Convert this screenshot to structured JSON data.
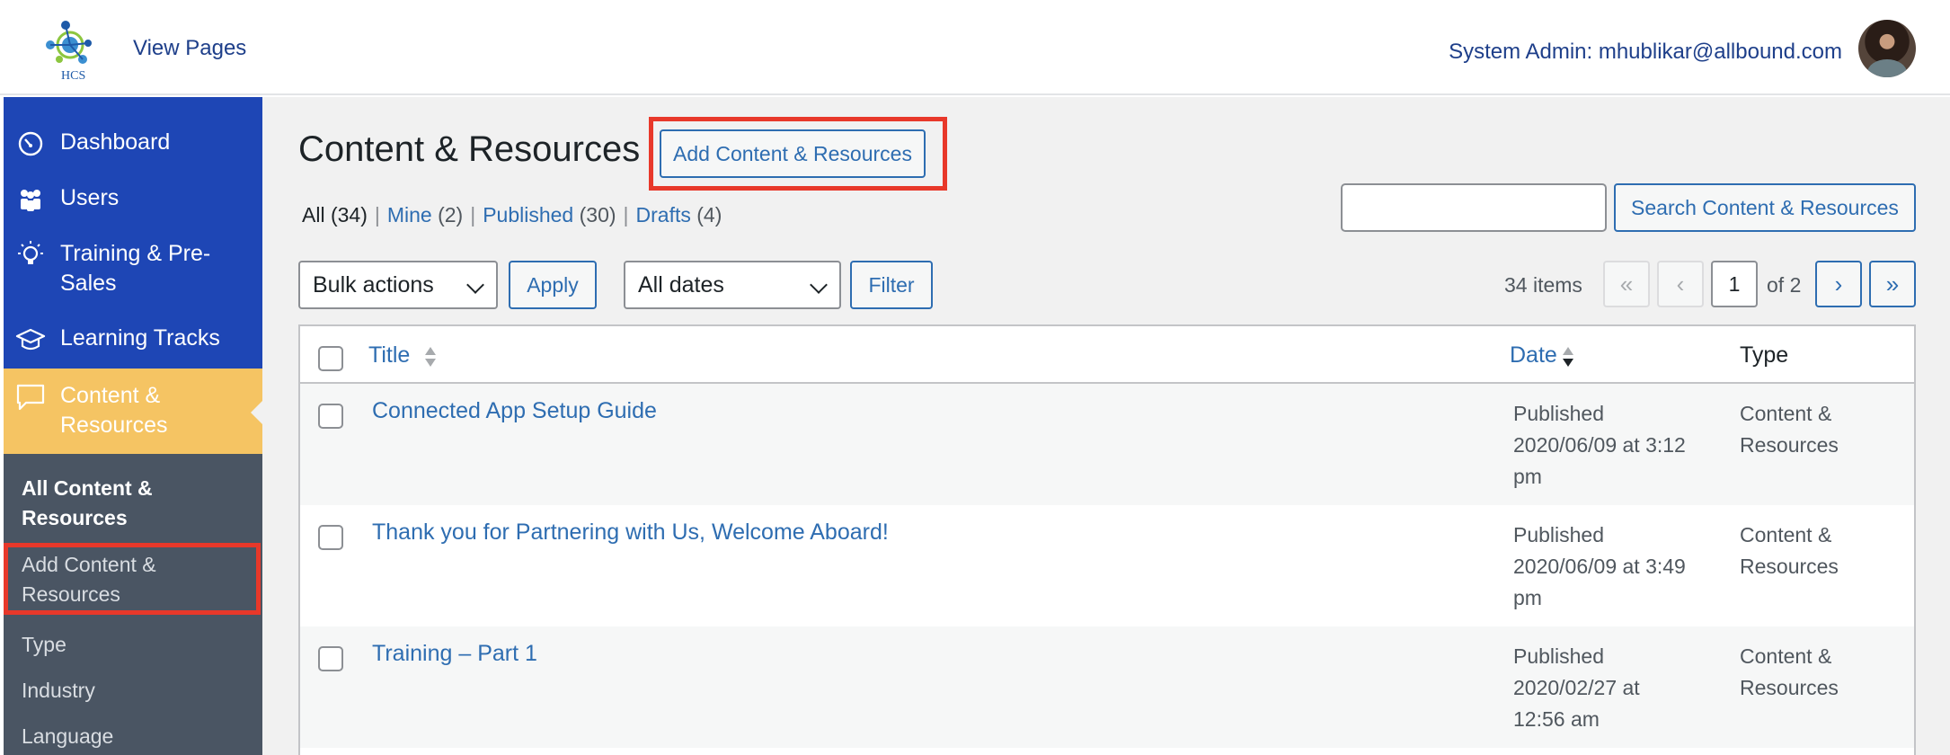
{
  "header": {
    "view_pages": "View Pages",
    "user": "System Admin: mhublikar@allbound.com",
    "logo_text": "HCS"
  },
  "sidebar": {
    "items": [
      {
        "label": "Dashboard",
        "icon": "dashboard-icon"
      },
      {
        "label": "Users",
        "icon": "users-icon"
      },
      {
        "label": "Training & Pre-Sales",
        "icon": "lightbulb-icon"
      },
      {
        "label": "Learning Tracks",
        "icon": "graduation-cap-icon"
      },
      {
        "label": "Content & Resources",
        "icon": "speech-bubble-icon",
        "active": true
      }
    ],
    "submenu": [
      {
        "label": "All Content & Resources",
        "current": true
      },
      {
        "label": "Add Content & Resources"
      },
      {
        "label": "Type"
      },
      {
        "label": "Industry"
      },
      {
        "label": "Language"
      }
    ]
  },
  "main": {
    "title": "Content & Resources",
    "add_button": "Add Content & Resources",
    "views": {
      "all": "All",
      "all_count": "(34)",
      "mine": "Mine",
      "mine_count": "(2)",
      "published": "Published",
      "published_count": "(30)",
      "drafts": "Drafts",
      "drafts_count": "(4)",
      "separator": "|"
    },
    "search": {
      "value": "",
      "button": "Search Content & Resources"
    },
    "bulk_actions": {
      "selected": "Bulk actions",
      "apply": "Apply"
    },
    "date_filter": {
      "selected": "All dates",
      "filter": "Filter"
    },
    "pagination": {
      "items": "34 items",
      "first": "«",
      "prev": "‹",
      "current": "1",
      "of": "of 2",
      "next": "›",
      "last": "»"
    }
  },
  "table": {
    "columns": {
      "title": "Title",
      "date": "Date",
      "type": "Type"
    },
    "rows": [
      {
        "title": "Connected App Setup Guide",
        "status": "Published",
        "date": "2020/06/09 at 3:12 pm",
        "type": "Content & Resources"
      },
      {
        "title": "Thank you for Partnering with Us, Welcome Aboard!",
        "status": "Published",
        "date": "2020/06/09 at 3:49 pm",
        "type": "Content & Resources"
      },
      {
        "title": "Training – Part 1",
        "status": "Published",
        "date": "2020/02/27 at 12:56 am",
        "type": "Content & Resources"
      }
    ]
  },
  "colors": {
    "sidebar": "#1e46b5",
    "active_item": "#f5c463",
    "submenu": "#4a5563",
    "link": "#2e6db1",
    "highlight": "#e8382a"
  }
}
